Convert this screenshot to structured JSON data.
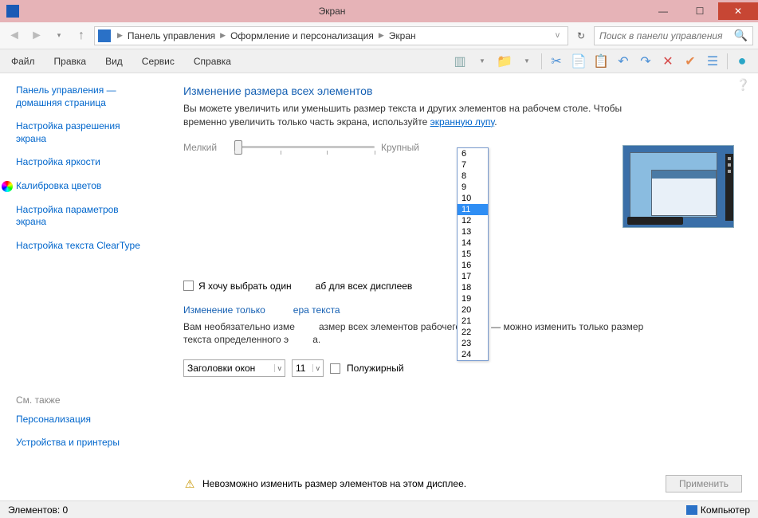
{
  "window": {
    "title": "Экран"
  },
  "breadcrumb": {
    "seg1": "Панель управления",
    "seg2": "Оформление и персонализация",
    "seg3": "Экран"
  },
  "search": {
    "placeholder": "Поиск в панели управления"
  },
  "menu": {
    "file": "Файл",
    "edit": "Правка",
    "view": "Вид",
    "service": "Сервис",
    "help": "Справка"
  },
  "sidebar": {
    "home_l1": "Панель управления —",
    "home_l2": "домашняя страница",
    "resolution_l1": "Настройка разрешения",
    "resolution_l2": "экрана",
    "brightness": "Настройка яркости",
    "calibration": "Калибровка цветов",
    "params_l1": "Настройка параметров",
    "params_l2": "экрана",
    "cleartype": "Настройка текста ClearType",
    "seealso": "См. также",
    "personalization": "Персонализация",
    "devices": "Устройства и принтеры"
  },
  "main": {
    "h1": "Изменение размера всех элементов",
    "p1_a": "Вы можете увеличить или уменьшить размер текста и других элементов на рабочем столе. Чтобы временно увеличить только часть экрана, используйте ",
    "p1_link": "экранную лупу",
    "slider_small": "Мелкий",
    "slider_large": "Крупный",
    "cb1_a": "Я хочу выбрать один",
    "cb1_b": "аб для всех дисплеев",
    "h2": "Изменение только",
    "h2_b": "ера текста",
    "p2_a": "Вам необязательно изме",
    "p2_b": "азмер всех элементов рабочего стола — можно изменить только размер текста определенного э",
    "p2_c": "а.",
    "select1": "Заголовки окон",
    "select2": "11",
    "bold": "Полужирный",
    "warning": "Невозможно изменить размер элементов на этом дисплее.",
    "apply": "Применить"
  },
  "dropdown": {
    "options": [
      "6",
      "7",
      "8",
      "9",
      "10",
      "11",
      "12",
      "13",
      "14",
      "15",
      "16",
      "17",
      "18",
      "19",
      "20",
      "21",
      "22",
      "23",
      "24"
    ],
    "selected": "11"
  },
  "status": {
    "left": "Элементов: 0",
    "right": "Компьютер"
  }
}
